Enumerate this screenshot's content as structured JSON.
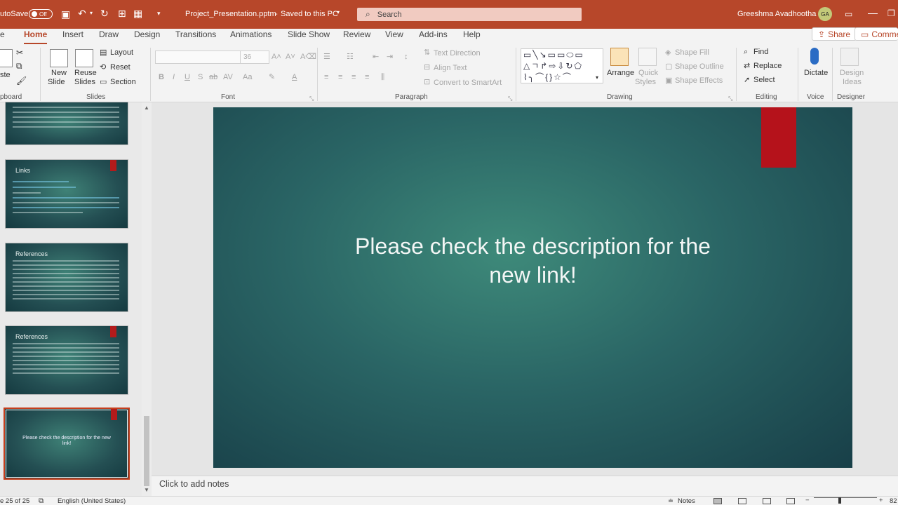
{
  "titlebar": {
    "autosave_label": "utoSave",
    "autosave_state": "Off",
    "file_name": "Project_Presentation.pptm",
    "save_status": "Saved to this PC",
    "search_placeholder": "Search",
    "user_name": "Greeshma Avadhootha",
    "user_initials": "GA"
  },
  "menu": {
    "tabs": [
      "Home",
      "Insert",
      "Draw",
      "Design",
      "Transitions",
      "Animations",
      "Slide Show",
      "Review",
      "View",
      "Add-ins",
      "Help"
    ],
    "active_tab": "Home",
    "share_label": "Share",
    "comments_label": "Comme"
  },
  "ribbon": {
    "clipboard": {
      "label": "pboard",
      "paste": "ste"
    },
    "slides": {
      "label": "Slides",
      "new_slide_1": "New",
      "new_slide_2": "Slide",
      "reuse_1": "Reuse",
      "reuse_2": "Slides",
      "layout": "Layout",
      "reset": "Reset",
      "section": "Section"
    },
    "font": {
      "label": "Font",
      "size": "36"
    },
    "paragraph": {
      "label": "Paragraph",
      "text_direction": "Text Direction",
      "align_text": "Align Text",
      "convert_smartart": "Convert to SmartArt"
    },
    "drawing": {
      "label": "Drawing",
      "arrange": "Arrange",
      "quick_styles_1": "Quick",
      "quick_styles_2": "Styles",
      "shape_fill": "Shape Fill",
      "shape_outline": "Shape Outline",
      "shape_effects": "Shape Effects"
    },
    "editing": {
      "label": "Editing",
      "find": "Find",
      "replace": "Replace",
      "select": "Select"
    },
    "voice": {
      "label": "Voice",
      "dictate": "Dictate"
    },
    "designer": {
      "label": "Designer",
      "design_ideas_1": "Design",
      "design_ideas_2": "Ideas"
    }
  },
  "thumbnails": [
    {
      "title": "",
      "selected": false
    },
    {
      "title": "Links",
      "selected": false
    },
    {
      "title": "References",
      "selected": false
    },
    {
      "title": "References",
      "selected": false
    },
    {
      "title": "",
      "text": "Please check the description for the new link!",
      "selected": true
    }
  ],
  "slide": {
    "text": "Please check the description for the new link!"
  },
  "notes": {
    "placeholder": "Click to add notes"
  },
  "status": {
    "slide_counter": "e 25 of 25",
    "language": "English (United States)",
    "notes_button": "Notes",
    "zoom": "82"
  },
  "colors": {
    "accent": "#b7472a",
    "slide_bg": "#2a6565",
    "slide_bar": "#b5121b"
  }
}
